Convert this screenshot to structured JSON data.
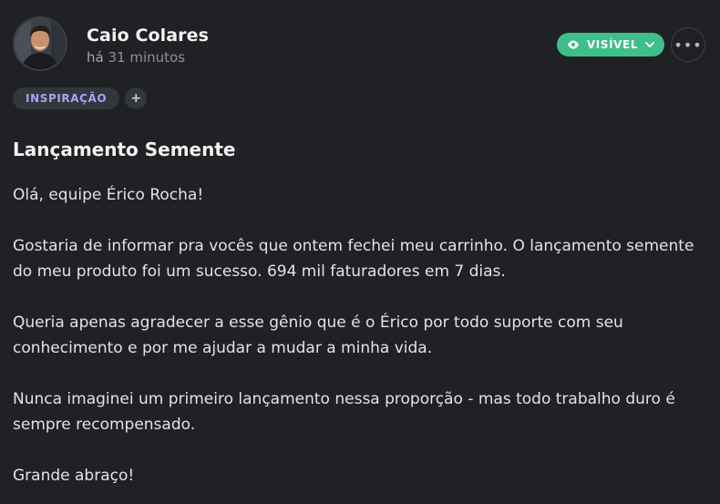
{
  "post": {
    "author": "Caio Colares",
    "time_prefix": "há",
    "time_value": "31 minutos",
    "visibility_label": "VISÍVEL",
    "more_label": "•••",
    "tags": [
      {
        "label": "INSPIRAÇÃO"
      }
    ],
    "add_tag_label": "+",
    "title": "Lançamento Semente",
    "paragraphs": [
      "Olá, equipe Érico Rocha!",
      "Gostaria de informar pra vocês que ontem fechei meu carrinho. O lançamento semente do meu produto foi um sucesso. 694 mil faturadores em 7 dias.",
      "Queria apenas agradecer a esse gênio que é o Érico por todo suporte com seu conhecimento e por me ajudar a mudar a minha vida.",
      "Nunca imaginei um primeiro lançamento nessa proporção - mas todo trabalho duro é sempre recompensado.",
      "Grande abraço!"
    ]
  },
  "colors": {
    "background": "#1f2124",
    "visibility_badge": "#3ebf8a",
    "tag_text": "#a7a4f7"
  },
  "icons": {
    "visibility": "eye-icon",
    "dropdown": "chevron-down-icon",
    "more": "more-horizontal-icon"
  }
}
